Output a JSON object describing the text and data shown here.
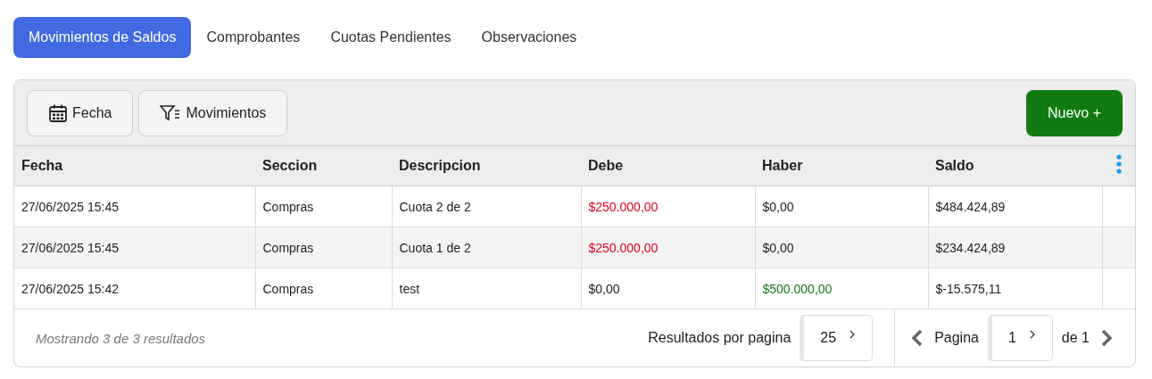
{
  "tabs": [
    {
      "label": "Movimientos de Saldos",
      "selected": true
    },
    {
      "label": "Comprobantes",
      "selected": false
    },
    {
      "label": "Cuotas Pendientes",
      "selected": false
    },
    {
      "label": "Observaciones",
      "selected": false
    }
  ],
  "toolbar": {
    "filters": [
      {
        "label": "Fecha",
        "kind": "calendar"
      },
      {
        "label": "Movimientos",
        "kind": "filter"
      }
    ],
    "new_button": "Nuevo +"
  },
  "table": {
    "columns": [
      "Fecha",
      "Seccion",
      "Descripcion",
      "Debe",
      "Haber",
      "Saldo"
    ],
    "rows": [
      [
        {
          "text": "27/06/2025 15:45",
          "color": "#222222"
        },
        {
          "text": "Compras",
          "color": "#222222"
        },
        {
          "text": "Cuota 2 de 2",
          "color": "#222222"
        },
        {
          "text": "$250.000,00",
          "color": "#e0001b"
        },
        {
          "text": "$0,00",
          "color": "#222222"
        },
        {
          "text": "$484.424,89",
          "color": "#222222"
        }
      ],
      [
        {
          "text": "27/06/2025 15:45",
          "color": "#222222"
        },
        {
          "text": "Compras",
          "color": "#222222"
        },
        {
          "text": "Cuota 1 de 2",
          "color": "#222222"
        },
        {
          "text": "$250.000,00",
          "color": "#e0001b"
        },
        {
          "text": "$0,00",
          "color": "#222222"
        },
        {
          "text": "$234.424,89",
          "color": "#222222"
        }
      ],
      [
        {
          "text": "27/06/2025 15:42",
          "color": "#222222"
        },
        {
          "text": "Compras",
          "color": "#222222"
        },
        {
          "text": "test",
          "color": "#222222"
        },
        {
          "text": "$0,00",
          "color": "#222222"
        },
        {
          "text": "$500.000,00",
          "color": "#117a11"
        },
        {
          "text": "$-15.575,11",
          "color": "#222222"
        }
      ]
    ]
  },
  "footer": {
    "summary": "Mostrando 3 de 3 resultados",
    "per_page_label": "Resultados por pagina",
    "per_page": "25",
    "page_label": "Pagina",
    "page": "1",
    "page_total": "de 1"
  }
}
